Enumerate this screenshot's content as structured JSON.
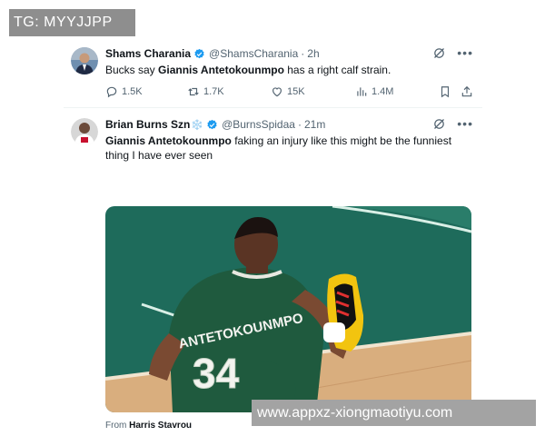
{
  "watermark_top": "TG: MYYJJPP",
  "watermark_bottom": "www.appxz-xiongmaotiyu.com",
  "tweet1": {
    "name": "Shams Charania",
    "handle": "@ShamsCharania",
    "time": "2h",
    "body_before": "Bucks say ",
    "body_bold": "Giannis Antetokounmpo",
    "body_after": " has a right calf strain.",
    "replies": "1.5K",
    "retweets": "1.7K",
    "likes": "15K",
    "views": "1.4M"
  },
  "tweet2": {
    "name": "Brian Burns Szn",
    "name_emoji": "❄️",
    "handle": "@BurnsSpidaa",
    "time": "21m",
    "body_bold": "Giannis Antetokounmpo",
    "body_after": " faking an injury like this might be the funniest thing I have ever seen",
    "jersey_name": "ANTETOKOUNMPO",
    "jersey_number": "34",
    "from_label": "From",
    "from_name": "Harris Stavrou"
  },
  "colors": {
    "verified": "#1d9bf0",
    "court_green": "#1e6b5b",
    "jersey_green": "#1f5a3e",
    "floor": "#d9ae7e"
  },
  "icons": {
    "reply": "reply-icon",
    "retweet": "retweet-icon",
    "like": "heart-icon",
    "views": "views-icon",
    "bookmark": "bookmark-icon",
    "share": "share-icon",
    "grok": "grok-icon",
    "more": "more-icon"
  }
}
